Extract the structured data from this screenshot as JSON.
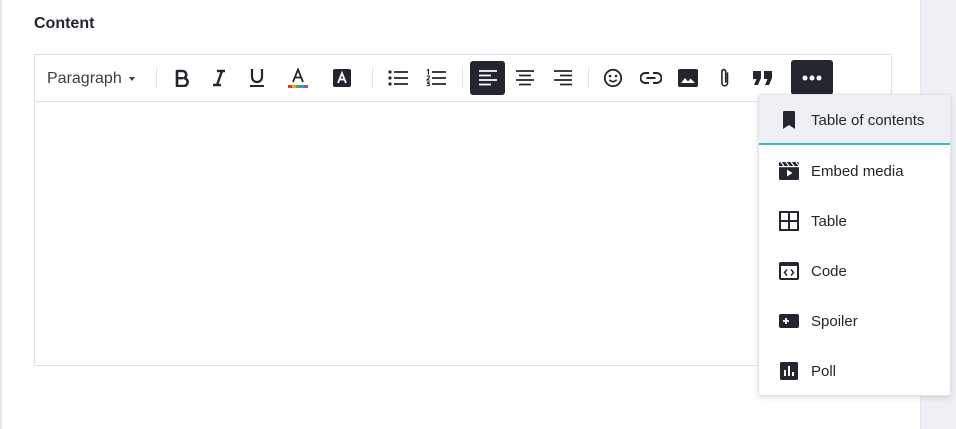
{
  "section_label": "Content",
  "toolbar": {
    "block_format": "Paragraph",
    "active_alignment": "left",
    "accent_color": "#23262e",
    "tools": [
      {
        "name": "bold",
        "icon": "bold-icon"
      },
      {
        "name": "italic",
        "icon": "italic-icon"
      },
      {
        "name": "underline",
        "icon": "underline-icon"
      },
      {
        "name": "text-color",
        "icon": "text-color-icon"
      },
      {
        "name": "highlight",
        "icon": "highlight-icon"
      },
      {
        "name": "bulleted-list",
        "icon": "bulleted-list-icon"
      },
      {
        "name": "numbered-list",
        "icon": "numbered-list-icon"
      },
      {
        "name": "align-left",
        "icon": "align-left-icon"
      },
      {
        "name": "align-center",
        "icon": "align-center-icon"
      },
      {
        "name": "align-right",
        "icon": "align-right-icon"
      },
      {
        "name": "emoji",
        "icon": "emoji-icon"
      },
      {
        "name": "link",
        "icon": "link-icon"
      },
      {
        "name": "image",
        "icon": "image-icon"
      },
      {
        "name": "attachment",
        "icon": "paperclip-icon"
      },
      {
        "name": "quote",
        "icon": "quote-icon"
      },
      {
        "name": "more",
        "icon": "more-dots-icon"
      }
    ]
  },
  "more_menu": {
    "highlight_color": "#3fb3cc",
    "selected_index": 0,
    "items": [
      {
        "label": "Table of contents",
        "icon": "bookmark-icon"
      },
      {
        "label": "Embed media",
        "icon": "video-icon"
      },
      {
        "label": "Table",
        "icon": "table-icon"
      },
      {
        "label": "Code",
        "icon": "code-icon"
      },
      {
        "label": "Spoiler",
        "icon": "spoiler-icon"
      },
      {
        "label": "Poll",
        "icon": "poll-icon"
      }
    ]
  }
}
